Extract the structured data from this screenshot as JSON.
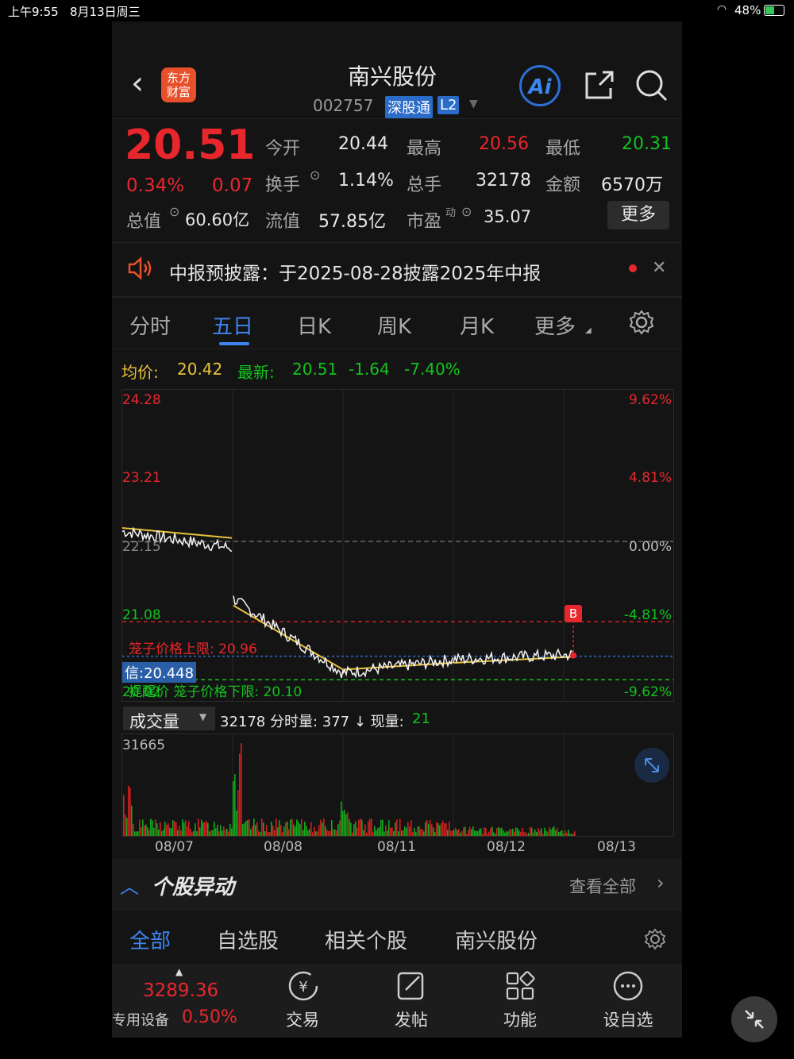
{
  "status": {
    "time": "上午9:55",
    "date": "8月13日周三",
    "battery": "48%"
  },
  "header": {
    "logo": "东方财富",
    "name": "南兴股份",
    "code": "002757",
    "tag": "深股通",
    "level": "L2",
    "ai": "Ai"
  },
  "quote": {
    "price": "20.51",
    "pct": "0.34%",
    "chg": "0.07",
    "open_label": "今开",
    "open": "20.44",
    "high_label": "最高",
    "high": "20.56",
    "low_label": "最低",
    "low": "20.31",
    "turnover_label": "换手",
    "turnover": "1.14%",
    "volume_label": "总手",
    "volume": "32178",
    "amount_label": "金额",
    "amount": "6570万",
    "mcap_label": "总值",
    "mcap": "60.60亿",
    "float_label": "流值",
    "float": "57.85亿",
    "pe_label": "市盈",
    "pe_sup": "动",
    "pe": "35.07",
    "more": "更多"
  },
  "notice": {
    "text": "中报预披露：于2025-08-28披露2025年中报"
  },
  "tabs": [
    "分时",
    "五日",
    "日K",
    "周K",
    "月K",
    "更多"
  ],
  "active_tab": 1,
  "info": {
    "avg_label": "均价:",
    "avg": "20.42",
    "latest_label": "最新:",
    "latest": "20.51",
    "latest_chg": "-1.64",
    "latest_pct": "-7.40%"
  },
  "chart_axes": {
    "y_left": [
      "24.28",
      "23.21",
      "22.15",
      "21.08",
      "20.02"
    ],
    "y_right": [
      "9.62%",
      "4.81%",
      "0.00%",
      "-4.81%",
      "-9.62%"
    ],
    "upper_limit": "笼子价格上限: 20.96",
    "lower_limit": "提醒价  笼子价格下限: 20.10",
    "cursor": "信:20.448",
    "marker": "B"
  },
  "volume_bar": {
    "selector": "成交量",
    "text": "32178 分时量: 377 ↓ 现量:",
    "now": "21",
    "max": "31665"
  },
  "dates": [
    "08/07",
    "08/08",
    "08/11",
    "08/12",
    "08/13"
  ],
  "chart_data": {
    "type": "line",
    "x": [
      "08/07",
      "08/08",
      "08/11",
      "08/12",
      "08/13"
    ],
    "ylim": [
      20.02,
      24.28
    ],
    "series": [
      {
        "values": [
          22.3,
          22.2,
          21.3,
          20.2,
          20.4,
          20.47
        ]
      },
      {
        "values": [
          22.35,
          22.25,
          21.2,
          20.25,
          20.35,
          20.42
        ]
      }
    ]
  },
  "alerts": {
    "title": "个股异动",
    "view_all": "查看全部"
  },
  "filter_tabs": [
    "全部",
    "自选股",
    "相关个股",
    "南兴股份"
  ],
  "bottom": {
    "index": "3289.36",
    "device": "专用设备",
    "device_pct": "0.50%",
    "trade": "交易",
    "post": "发帖",
    "func": "功能",
    "watch": "设自选"
  }
}
